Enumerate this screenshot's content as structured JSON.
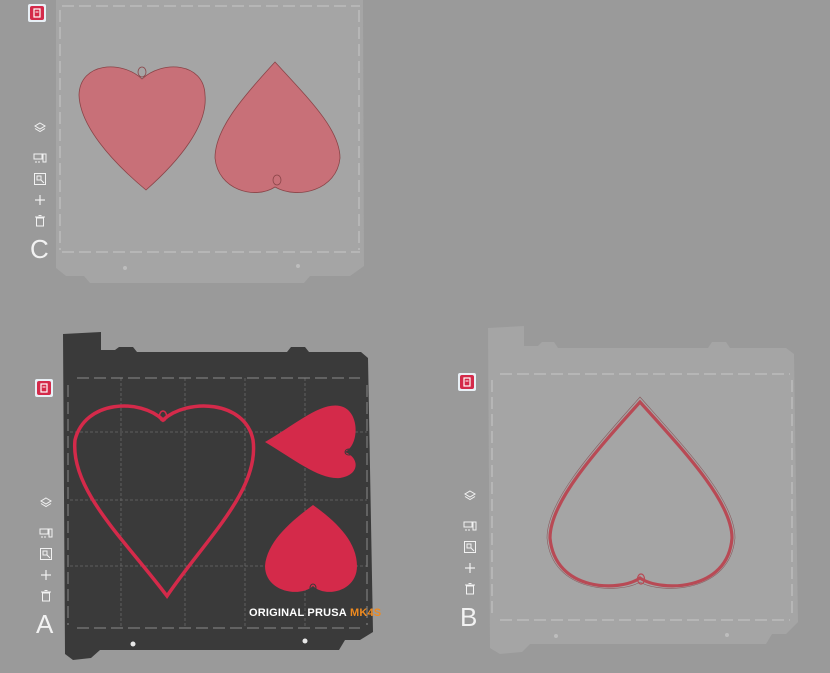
{
  "colors": {
    "background": "#9a9a9a",
    "plate_inactive": "#a5a5a5",
    "plate_active": "#3a3a3a",
    "heart_filled": "#d42a4a",
    "heart_ghost": "#c87078",
    "accent_model": "#ef8a1f"
  },
  "plates": {
    "A": {
      "letter": "A",
      "brand": "ORIGINAL PRUSA",
      "model": "MK4S",
      "state": "active"
    },
    "B": {
      "letter": "B",
      "state": "inactive"
    },
    "C": {
      "letter": "C",
      "state": "inactive"
    }
  },
  "toolbar_icons": [
    "layers-icon",
    "arrange-icon",
    "orient-icon",
    "add-icon",
    "delete-icon"
  ]
}
